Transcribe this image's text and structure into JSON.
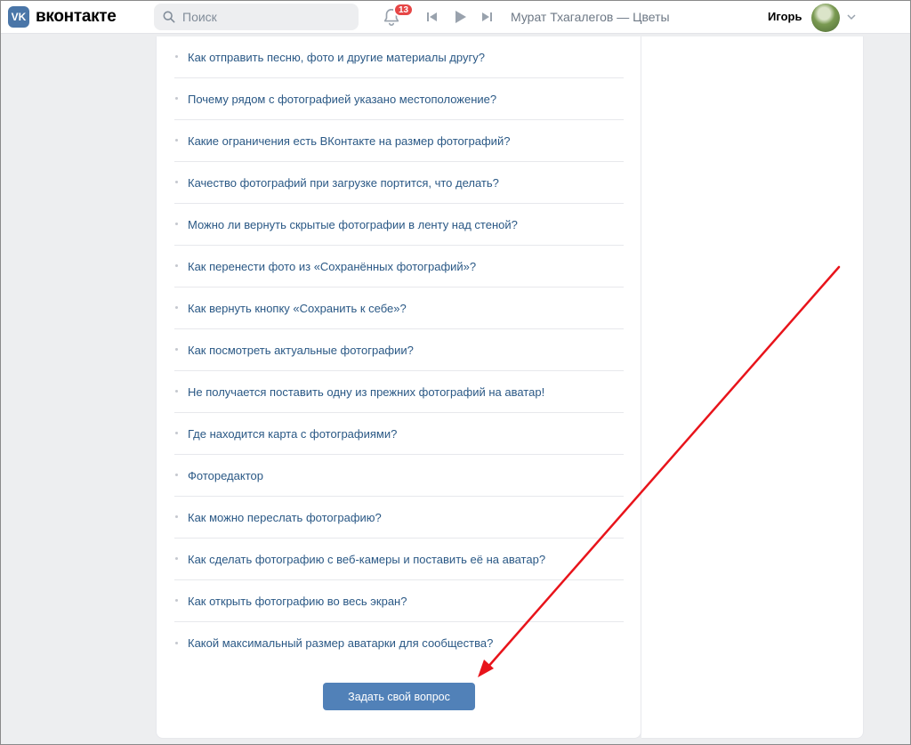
{
  "header": {
    "logo_text": "вконтакте",
    "logo_mark": "VK",
    "search_placeholder": "Поиск",
    "notifications_count": "13",
    "now_playing": "Мурат Тхагалегов — Цветы",
    "user_name": "Игорь"
  },
  "faq": {
    "items": [
      "Как отправить песню, фото и другие материалы другу?",
      "Почему рядом с фотографией указано местоположение?",
      "Какие ограничения есть ВКонтакте на размер фотографий?",
      "Качество фотографий при загрузке портится, что делать?",
      "Можно ли вернуть скрытые фотографии в ленту над стеной?",
      "Как перенести фото из «Сохранённых фотографий»?",
      "Как вернуть кнопку «Сохранить к себе»?",
      "Как посмотреть актуальные фотографии?",
      "Не получается поставить одну из прежних фотографий на аватар!",
      "Где находится карта с фотографиями?",
      "Фоторедактор",
      "Как можно переслать фотографию?",
      "Как сделать фотографию с веб-камеры и поставить её на аватар?",
      "Как открыть фотографию во весь экран?",
      "Какой максимальный размер аватарки для сообщества?"
    ],
    "ask_button_label": "Задать свой вопрос"
  },
  "colors": {
    "accent": "#5181b8",
    "link": "#2a5885",
    "badge": "#e64646",
    "annotation_arrow": "#e8141b"
  },
  "icons": [
    "vk-logo-icon",
    "search-icon",
    "bell-icon",
    "previous-track-icon",
    "play-icon",
    "next-track-icon",
    "chevron-down-icon"
  ]
}
